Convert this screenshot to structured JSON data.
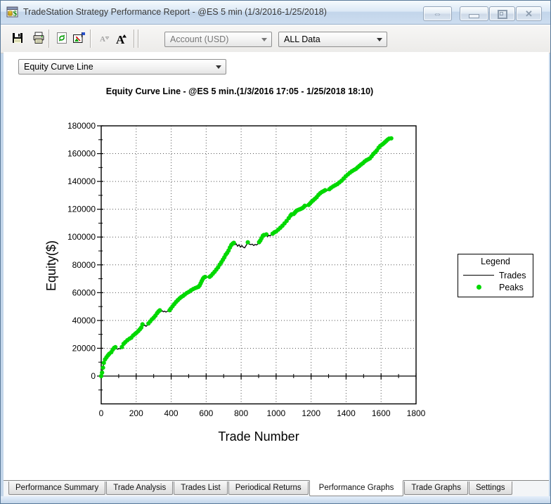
{
  "window": {
    "title": "TradeStation Strategy Performance Report - @ES 5 min (1/3/2016-1/25/2018)",
    "controls": {
      "dock_glyph": "⇔",
      "close_glyph": "✕"
    }
  },
  "toolbar": {
    "account_dropdown": {
      "value": "Account (USD)",
      "disabled": true
    },
    "data_dropdown": {
      "value": "ALL Data"
    }
  },
  "graph_selector": {
    "value": "Equity Curve Line"
  },
  "legend": {
    "title": "Legend",
    "items": [
      {
        "label": "Trades",
        "type": "line",
        "color": "#000000"
      },
      {
        "label": "Peaks",
        "type": "dot",
        "color": "#00d800"
      }
    ]
  },
  "tabs": {
    "active": "Performance Graphs",
    "items": [
      "Performance Summary",
      "Trade Analysis",
      "Trades List",
      "Periodical Returns",
      "Performance Graphs",
      "Trade Graphs",
      "Settings"
    ]
  },
  "chart_data": {
    "type": "line",
    "title": "Equity Curve Line - @ES 5 min.(1/3/2016 17:05 - 1/25/2018 18:10)",
    "xlabel": "Trade Number",
    "ylabel": "Equity($)",
    "xlim": [
      0,
      1800
    ],
    "ylim": [
      -20000,
      180000
    ],
    "grid": "dotted-at-major-ticks",
    "legend_position": "right",
    "x_ticks": {
      "major": [
        0,
        200,
        400,
        600,
        800,
        1000,
        1200,
        1400,
        1600,
        1800
      ],
      "minor_step": 100
    },
    "y_ticks": {
      "major": [
        0,
        20000,
        40000,
        60000,
        80000,
        100000,
        120000,
        140000,
        160000,
        180000
      ],
      "minor_step": 10000
    },
    "series": [
      {
        "name": "Trades",
        "type": "line",
        "color": "#000000",
        "points": [
          [
            0,
            0
          ],
          [
            5,
            2500
          ],
          [
            10,
            6000
          ],
          [
            15,
            9500
          ],
          [
            22,
            12000
          ],
          [
            30,
            13500
          ],
          [
            38,
            14800
          ],
          [
            46,
            16000
          ],
          [
            52,
            15600
          ],
          [
            58,
            17200
          ],
          [
            66,
            19000
          ],
          [
            74,
            20300
          ],
          [
            81,
            20800
          ],
          [
            88,
            19600
          ],
          [
            95,
            19300
          ],
          [
            103,
            19800
          ],
          [
            110,
            19500
          ],
          [
            118,
            20900
          ],
          [
            128,
            23200
          ],
          [
            138,
            24400
          ],
          [
            150,
            25800
          ],
          [
            162,
            26900
          ],
          [
            172,
            27600
          ],
          [
            183,
            29200
          ],
          [
            194,
            30400
          ],
          [
            202,
            31200
          ],
          [
            212,
            32400
          ],
          [
            221,
            33600
          ],
          [
            229,
            34900
          ],
          [
            236,
            37200
          ],
          [
            244,
            36200
          ],
          [
            250,
            36600
          ],
          [
            256,
            35800
          ],
          [
            263,
            36500
          ],
          [
            270,
            37800
          ],
          [
            280,
            39300
          ],
          [
            290,
            40800
          ],
          [
            300,
            42000
          ],
          [
            310,
            43500
          ],
          [
            320,
            45300
          ],
          [
            328,
            46500
          ],
          [
            335,
            47300
          ],
          [
            342,
            46400
          ],
          [
            349,
            46900
          ],
          [
            356,
            46200
          ],
          [
            363,
            46700
          ],
          [
            370,
            46000
          ],
          [
            377,
            46500
          ],
          [
            384,
            46900
          ],
          [
            391,
            47400
          ],
          [
            398,
            48600
          ],
          [
            408,
            50200
          ],
          [
            418,
            51800
          ],
          [
            428,
            53300
          ],
          [
            438,
            54600
          ],
          [
            448,
            55800
          ],
          [
            458,
            56900
          ],
          [
            468,
            57700
          ],
          [
            478,
            58700
          ],
          [
            490,
            59800
          ],
          [
            502,
            60600
          ],
          [
            514,
            61700
          ],
          [
            526,
            62600
          ],
          [
            538,
            63300
          ],
          [
            548,
            63800
          ],
          [
            556,
            64200
          ],
          [
            563,
            65200
          ],
          [
            569,
            66800
          ],
          [
            575,
            68400
          ],
          [
            581,
            69900
          ],
          [
            587,
            70900
          ],
          [
            594,
            71300
          ],
          [
            601,
            70900
          ],
          [
            608,
            71200
          ],
          [
            614,
            71000
          ],
          [
            620,
            71400
          ],
          [
            628,
            72200
          ],
          [
            638,
            73600
          ],
          [
            648,
            75000
          ],
          [
            658,
            76600
          ],
          [
            668,
            78200
          ],
          [
            678,
            80200
          ],
          [
            687,
            81900
          ],
          [
            696,
            83700
          ],
          [
            704,
            85400
          ],
          [
            712,
            87300
          ],
          [
            720,
            88600
          ],
          [
            728,
            90300
          ],
          [
            736,
            92500
          ],
          [
            744,
            94300
          ],
          [
            752,
            95300
          ],
          [
            758,
            95800
          ],
          [
            765,
            94500
          ],
          [
            772,
            95100
          ],
          [
            780,
            93400
          ],
          [
            788,
            94500
          ],
          [
            796,
            92800
          ],
          [
            804,
            93900
          ],
          [
            812,
            92700
          ],
          [
            820,
            92200
          ],
          [
            830,
            94300
          ],
          [
            838,
            96200
          ],
          [
            846,
            94900
          ],
          [
            856,
            94600
          ],
          [
            864,
            94900
          ],
          [
            872,
            93900
          ],
          [
            880,
            94700
          ],
          [
            888,
            94300
          ],
          [
            896,
            95100
          ],
          [
            903,
            96300
          ],
          [
            910,
            97600
          ],
          [
            917,
            99200
          ],
          [
            924,
            100900
          ],
          [
            930,
            101500
          ],
          [
            937,
            100600
          ],
          [
            944,
            101900
          ],
          [
            951,
            100300
          ],
          [
            958,
            101300
          ],
          [
            965,
            100800
          ],
          [
            972,
            101700
          ],
          [
            980,
            102400
          ],
          [
            990,
            103400
          ],
          [
            1000,
            104000
          ],
          [
            1012,
            105300
          ],
          [
            1024,
            106700
          ],
          [
            1036,
            108100
          ],
          [
            1048,
            109800
          ],
          [
            1060,
            111600
          ],
          [
            1072,
            113600
          ],
          [
            1082,
            115400
          ],
          [
            1088,
            116300
          ],
          [
            1094,
            115900
          ],
          [
            1100,
            116600
          ],
          [
            1106,
            117400
          ],
          [
            1112,
            118300
          ],
          [
            1118,
            119000
          ],
          [
            1126,
            119500
          ],
          [
            1134,
            119900
          ],
          [
            1142,
            120300
          ],
          [
            1150,
            120800
          ],
          [
            1158,
            121600
          ],
          [
            1164,
            122500
          ],
          [
            1171,
            121700
          ],
          [
            1178,
            122300
          ],
          [
            1186,
            123100
          ],
          [
            1194,
            124200
          ],
          [
            1202,
            125300
          ],
          [
            1212,
            126400
          ],
          [
            1222,
            127500
          ],
          [
            1232,
            128700
          ],
          [
            1242,
            130300
          ],
          [
            1252,
            131500
          ],
          [
            1262,
            132400
          ],
          [
            1272,
            133100
          ],
          [
            1280,
            133700
          ],
          [
            1288,
            133200
          ],
          [
            1296,
            133600
          ],
          [
            1304,
            134400
          ],
          [
            1314,
            135400
          ],
          [
            1326,
            136400
          ],
          [
            1338,
            137300
          ],
          [
            1350,
            138100
          ],
          [
            1362,
            139300
          ],
          [
            1374,
            140500
          ],
          [
            1386,
            142100
          ],
          [
            1398,
            143700
          ],
          [
            1410,
            145000
          ],
          [
            1422,
            146300
          ],
          [
            1434,
            147400
          ],
          [
            1446,
            148300
          ],
          [
            1456,
            149000
          ],
          [
            1466,
            150100
          ],
          [
            1476,
            151200
          ],
          [
            1486,
            152200
          ],
          [
            1496,
            153100
          ],
          [
            1506,
            154300
          ],
          [
            1516,
            155200
          ],
          [
            1526,
            155900
          ],
          [
            1536,
            156600
          ],
          [
            1546,
            158100
          ],
          [
            1556,
            159800
          ],
          [
            1566,
            161000
          ],
          [
            1576,
            162300
          ],
          [
            1586,
            164200
          ],
          [
            1596,
            165600
          ],
          [
            1606,
            166500
          ],
          [
            1614,
            167300
          ],
          [
            1622,
            168200
          ],
          [
            1630,
            169200
          ],
          [
            1638,
            170100
          ],
          [
            1646,
            170800
          ],
          [
            1652,
            170300
          ],
          [
            1658,
            171000
          ]
        ]
      },
      {
        "name": "Peaks",
        "type": "running-max-dots",
        "color": "#00d800",
        "dot_radius": 3.1
      }
    ]
  }
}
